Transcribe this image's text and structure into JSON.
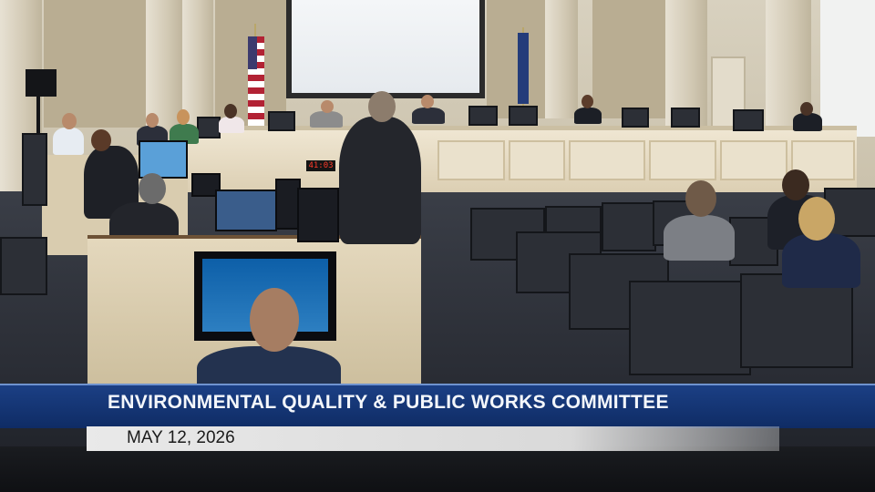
{
  "broadcast": {
    "title": "ENVIRONMENTAL QUALITY & PUBLIC WORKS COMMITTEE",
    "date": "MAY 12, 2026"
  },
  "room": {
    "clock_display": "41:03"
  },
  "colors": {
    "banner": "#1b3f84",
    "date_bar": "#e0e0e0",
    "wall": "#d2c9b4",
    "floor": "#2c2f37"
  }
}
